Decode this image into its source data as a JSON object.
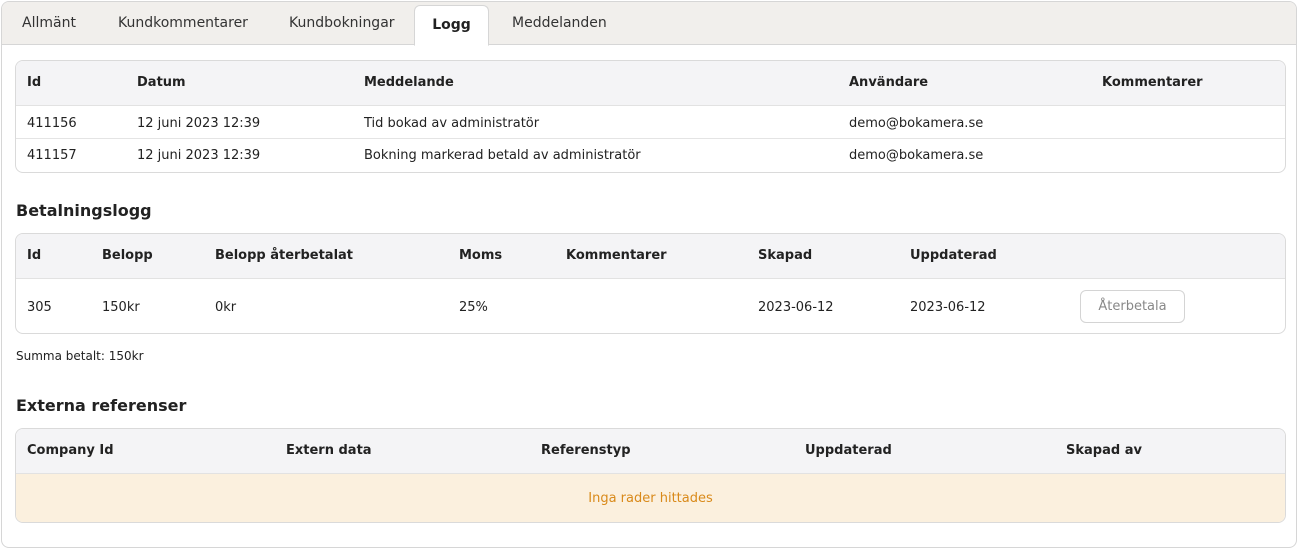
{
  "tabs": [
    {
      "label": "Allmänt",
      "active": false
    },
    {
      "label": "Kundkommentarer",
      "active": false
    },
    {
      "label": "Kundbokningar",
      "active": false
    },
    {
      "label": "Logg",
      "active": true
    },
    {
      "label": "Meddelanden",
      "active": false
    }
  ],
  "log_table": {
    "headers": [
      "Id",
      "Datum",
      "Meddelande",
      "Användare",
      "Kommentarer"
    ],
    "rows": [
      [
        "411156",
        "12 juni 2023 12:39",
        "Tid bokad av administratör",
        "demo@bokamera.se",
        ""
      ],
      [
        "411157",
        "12 juni 2023 12:39",
        "Bokning markerad betald av administratör",
        "demo@bokamera.se",
        ""
      ]
    ]
  },
  "payment_log": {
    "title": "Betalningslogg",
    "headers": [
      "Id",
      "Belopp",
      "Belopp återbetalat",
      "Moms",
      "Kommentarer",
      "Skapad",
      "Uppdaterad"
    ],
    "rows": [
      [
        "305",
        "150kr",
        "0kr",
        "25%",
        "",
        "2023-06-12",
        "2023-06-12"
      ]
    ],
    "refund_button_label": "Återbetala",
    "total_text": "Summa betalt: 150kr"
  },
  "external_refs": {
    "title": "Externa referenser",
    "headers": [
      "Company Id",
      "Extern data",
      "Referenstyp",
      "Uppdaterad",
      "Skapad av"
    ],
    "empty_text": "Inga rader hittades",
    "empty_bg_color": "#fbf0de",
    "empty_text_color": "#d98a1a"
  }
}
